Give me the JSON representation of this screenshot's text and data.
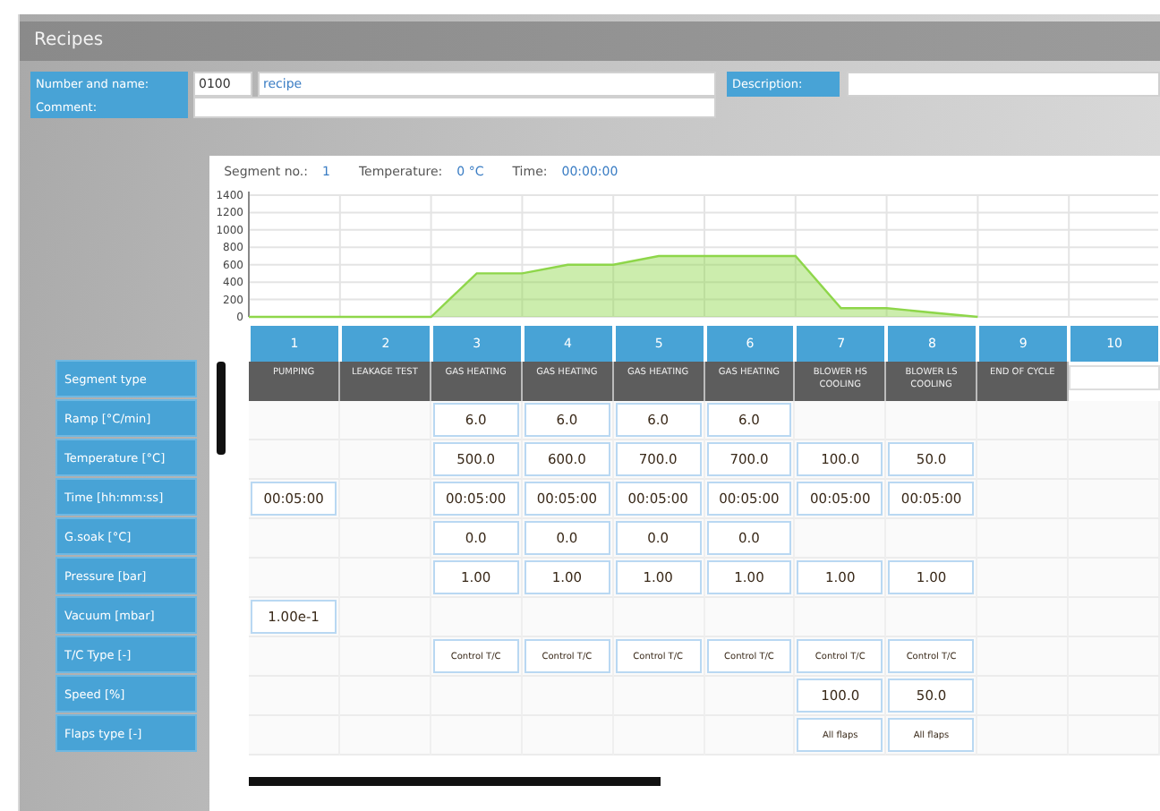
{
  "window": {
    "title": "Recipes"
  },
  "header": {
    "number_label": "Number and name:",
    "number": "0100",
    "name": "recipe",
    "comment_label": "Comment:",
    "description_label": "Description:"
  },
  "status": {
    "segment_label": "Segment no.:",
    "segment": "1",
    "temperature_label": "Temperature:",
    "temperature": "0 °C",
    "time_label": "Time:",
    "time": "00:00:00"
  },
  "chart_data": {
    "type": "area",
    "categories": [
      null,
      null,
      null,
      null,
      null,
      null,
      null,
      null,
      null,
      null,
      null,
      null,
      null,
      null,
      null,
      null,
      null
    ],
    "series": [
      {
        "color": "#8ed64a",
        "values": [
          0,
          0,
          0,
          0,
          0,
          500,
          500,
          600,
          600,
          700,
          700,
          700,
          700,
          100,
          100,
          50,
          0
        ]
      }
    ],
    "grid": true,
    "ylim": [
      0,
      1400
    ],
    "yticks": [
      0,
      200,
      400,
      600,
      800,
      1000,
      1200,
      1400
    ]
  },
  "rows": [
    "Segment type",
    "Ramp [°C/min]",
    "Temperature [°C]",
    "Time [hh:mm:ss]",
    "G.soak [°C]",
    "Pressure [bar]",
    "Vacuum [mbar]",
    "T/C Type [-]",
    "Speed [%]",
    "Flaps type [-]"
  ],
  "segments": [
    {
      "number": "1",
      "type": "PUMPING",
      "cells": [
        null,
        null,
        "00:05:00",
        null,
        null,
        "1.00e-1",
        null,
        null,
        null
      ]
    },
    {
      "number": "2",
      "type": "LEAKAGE TEST",
      "cells": [
        null,
        null,
        null,
        null,
        null,
        null,
        null,
        null,
        null
      ]
    },
    {
      "number": "3",
      "type": "GAS HEATING",
      "cells": [
        "6.0",
        "500.0",
        "00:05:00",
        "0.0",
        "1.00",
        null,
        "Control T/C",
        null,
        null
      ]
    },
    {
      "number": "4",
      "type": "GAS HEATING",
      "cells": [
        "6.0",
        "600.0",
        "00:05:00",
        "0.0",
        "1.00",
        null,
        "Control T/C",
        null,
        null
      ]
    },
    {
      "number": "5",
      "type": "GAS HEATING",
      "cells": [
        "6.0",
        "700.0",
        "00:05:00",
        "0.0",
        "1.00",
        null,
        "Control T/C",
        null,
        null
      ]
    },
    {
      "number": "6",
      "type": "GAS HEATING",
      "cells": [
        "6.0",
        "700.0",
        "00:05:00",
        "0.0",
        "1.00",
        null,
        "Control T/C",
        null,
        null
      ]
    },
    {
      "number": "7",
      "type": "BLOWER HS COOLING",
      "cells": [
        null,
        "100.0",
        "00:05:00",
        null,
        "1.00",
        null,
        "Control T/C",
        "100.0",
        "All flaps"
      ]
    },
    {
      "number": "8",
      "type": "BLOWER LS COOLING",
      "cells": [
        null,
        "50.0",
        "00:05:00",
        null,
        "1.00",
        null,
        "Control T/C",
        "50.0",
        "All flaps"
      ]
    },
    {
      "number": "9",
      "type": "END OF CYCLE",
      "cells": [
        null,
        null,
        null,
        null,
        null,
        null,
        null,
        null,
        null
      ]
    },
    {
      "number": "10",
      "cells": [
        null,
        null,
        null,
        null,
        null,
        null,
        null,
        null,
        null
      ]
    }
  ]
}
